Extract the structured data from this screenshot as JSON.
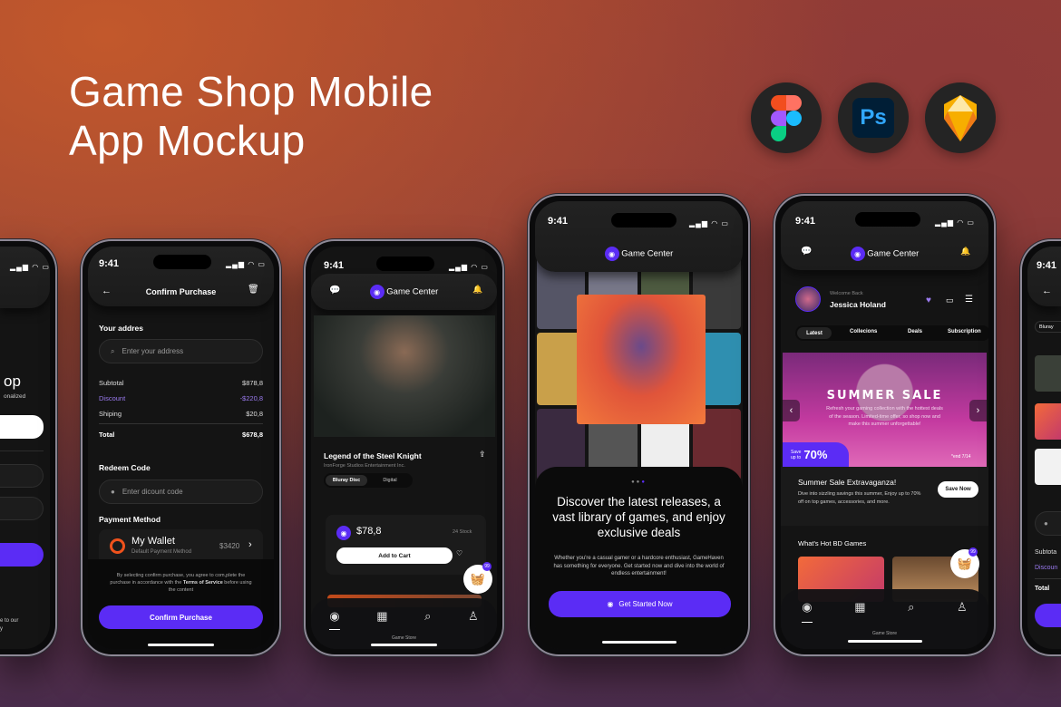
{
  "hero": {
    "title_line1": "Game Shop Mobile",
    "title_line2": "App Mockup"
  },
  "tools": [
    {
      "name": "figma-icon"
    },
    {
      "name": "photoshop-icon",
      "label": "Ps"
    },
    {
      "name": "sketch-icon"
    }
  ],
  "colors": {
    "accent": "#5b2cf5",
    "discount": "#9b7bf0",
    "screen": "#141414",
    "notification": "#e5283a"
  },
  "status": {
    "time": "9:41"
  },
  "app": {
    "name": "Game Center",
    "nav_active_label": "Game Store"
  },
  "phone_signin": {
    "title_fragment": "op",
    "subtitle_fragment": "onalized",
    "terms_line1": "e to our",
    "terms_line2": "y"
  },
  "phone_checkout": {
    "title": "Confirm Purchase",
    "address_label": "Your addres",
    "address_placeholder": "Enter your address",
    "summary": [
      {
        "label": "Subtotal",
        "value": "$878,8"
      },
      {
        "label": "Discount",
        "value": "-$220,8"
      },
      {
        "label": "Shiping",
        "value": "$20,8"
      }
    ],
    "total": {
      "label": "Total",
      "value": "$678,8"
    },
    "redeem_label": "Redeem Code",
    "redeem_placeholder": "Enter dicount code",
    "payment_label": "Payment Method",
    "wallet": {
      "name": "My Wallet",
      "sub": "Default Payment Method",
      "amount": "$3420"
    },
    "terms_pre": "By selecting confirm purchase, you agree to com,plete the purchase in accordance with the",
    "terms_link": "Terms of Service",
    "terms_post": "before using the content",
    "confirm_button": "Confirm Purchase"
  },
  "phone_product": {
    "title": "Legend of the Steel Knight",
    "publisher": "IronForge Studios Entertainment Inc.",
    "formats": [
      "Bluray Disc",
      "Digital"
    ],
    "selected_format": "Bluray Disc",
    "price": "$78,8",
    "stock": "24 Stock",
    "add_to_cart": "Add to Cart",
    "cart_badge": "99"
  },
  "phone_onboarding": {
    "page_index": 3,
    "page_count": 3,
    "headline": "Discover the latest releases, a vast library of games, and enjoy exclusive deals",
    "body": "Whether you're a casual gamer or a hardcore enthusiast, GameHaven has something for everyone. Get started now and dive into the world of endless entertainment!",
    "cta": "Get Started Now"
  },
  "phone_home": {
    "welcome": "Welcome Back",
    "user": "Jessica Holand",
    "tabs": [
      "Latest",
      "Collecions",
      "Deals",
      "Subscription"
    ],
    "active_tab": "Latest",
    "banner": {
      "title": "SUMMER SALE",
      "text": "Refresh your gaming collection with the hottest deals of the season. Limited-time offer, so shop now and make this summer unforgettable!",
      "save_pre1": "Save",
      "save_pre2": "up to",
      "save_pct": "70%",
      "ends": "*end 7/14"
    },
    "promo": {
      "title": "Summer Sale Extravaganza!",
      "text": "Dive into sizzling savings this summer, Enjoy up to 70% off on top games, accessories, and more.",
      "button": "Save Now"
    },
    "section": "What's Hot BD Games",
    "cart_badge": "99"
  },
  "phone_cart": {
    "chip": "Bluray",
    "rows": [
      "Subtota",
      "Discoun",
      "Total"
    ]
  }
}
